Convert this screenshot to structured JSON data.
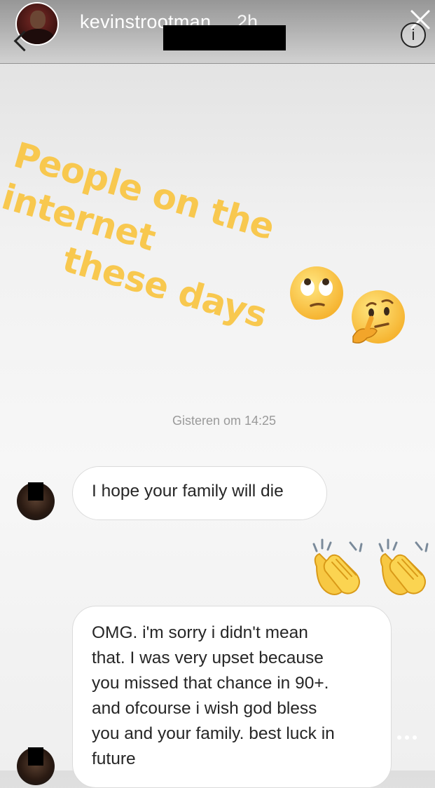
{
  "header": {
    "username": "kevinstrootman",
    "time": "2h",
    "avatar_icon": "profile-photo",
    "close_icon": "close-icon",
    "info_label": "i",
    "back_icon": "chevron-left-icon"
  },
  "story": {
    "headline_line1": "People on the internet",
    "headline_line2": "these days",
    "headline_color": "#f8c84f",
    "emojis": [
      "face-with-rolling-eyes",
      "thinking-face"
    ]
  },
  "chat": {
    "timestamp": "Gisteren om 14:25",
    "message1": "I hope your family will die",
    "reaction": "clapping-hands",
    "message2_lines": [
      "OMG.  i'm sorry i didn't mean",
      "that. I was very upset because",
      "you missed that chance in 90+.",
      "and ofcourse i wish god bless",
      "you and your family. best luck in",
      "future"
    ]
  },
  "footer": {
    "send_icon": "send-icon",
    "more_icon": "more-dots-icon"
  }
}
